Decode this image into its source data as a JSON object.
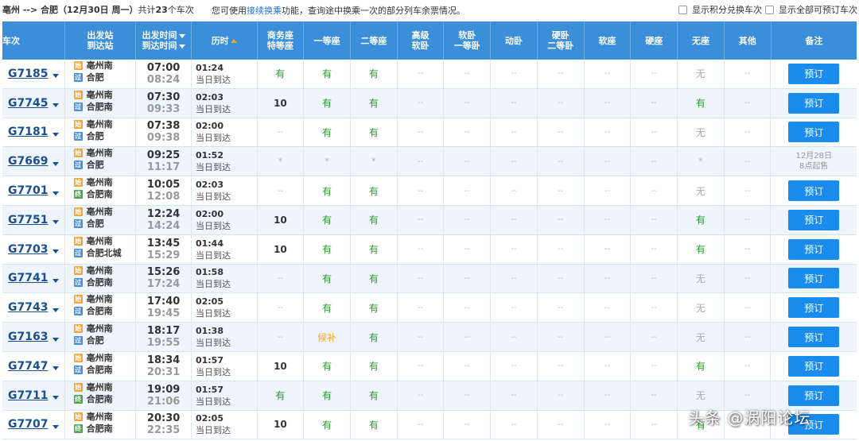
{
  "topbar": {
    "route": "亳州 --> 合肥（12月30日 周一）",
    "count_prefix": "共计",
    "count": "23",
    "count_suffix": "个车次",
    "notice_prefix": "您可使用",
    "notice_link": "接续换乘",
    "notice_suffix": "功能，查询途中换乘一次的部分列车余票情况。",
    "opt1": "显示积分兑换车次",
    "opt2": "显示全部可预订车次"
  },
  "headers": {
    "train": "车次",
    "station_a": "出发站",
    "station_b": "到达站",
    "time_a": "出发时间",
    "time_b": "到达时间",
    "duration": "历时",
    "seat1_a": "商务座",
    "seat1_b": "特等座",
    "seat2": "一等座",
    "seat3": "二等座",
    "seat4_a": "高级",
    "seat4_b": "软卧",
    "seat5_a": "软卧",
    "seat5_b": "一等卧",
    "seat6": "动卧",
    "seat7_a": "硬卧",
    "seat7_b": "二等卧",
    "seat8": "软座",
    "seat9": "硬座",
    "seat10": "无座",
    "seat11": "其他",
    "note": "备注"
  },
  "badges": {
    "start": "始",
    "pass": "过",
    "end": "终"
  },
  "book_label": "预订",
  "rows": [
    {
      "no": "G7185",
      "from": "亳州南",
      "to": "合肥",
      "to_badge": "pass",
      "dep": "07:00",
      "arr": "08:24",
      "dur": "01:24",
      "day": "当日到达",
      "s": [
        "有",
        "有",
        "有",
        "--",
        "--",
        "--",
        "--",
        "--",
        "--",
        "无",
        "--"
      ],
      "note": "book"
    },
    {
      "no": "G7745",
      "from": "亳州南",
      "to": "合肥南",
      "to_badge": "pass",
      "dep": "07:30",
      "arr": "09:33",
      "dur": "02:03",
      "day": "当日到达",
      "s": [
        "10",
        "有",
        "有",
        "--",
        "--",
        "--",
        "--",
        "--",
        "--",
        "有",
        "--"
      ],
      "note": "book"
    },
    {
      "no": "G7181",
      "from": "亳州南",
      "to": "合肥",
      "to_badge": "pass",
      "dep": "07:38",
      "arr": "09:38",
      "dur": "02:00",
      "day": "当日到达",
      "s": [
        "--",
        "有",
        "有",
        "--",
        "--",
        "--",
        "--",
        "--",
        "--",
        "无",
        "--"
      ],
      "note": "book"
    },
    {
      "no": "G7669",
      "from": "亳州南",
      "to": "合肥",
      "to_badge": "pass",
      "dep": "09:25",
      "arr": "11:17",
      "dur": "01:52",
      "day": "当日到达",
      "s": [
        "*",
        "*",
        "*",
        "--",
        "--",
        "--",
        "--",
        "--",
        "--",
        "*",
        "--"
      ],
      "note": "presale",
      "presale_1": "12月28日",
      "presale_2": "8点起售"
    },
    {
      "no": "G7701",
      "from": "亳州南",
      "to": "合肥南",
      "to_badge": "end",
      "dep": "10:05",
      "arr": "12:08",
      "dur": "02:03",
      "day": "当日到达",
      "s": [
        "--",
        "有",
        "有",
        "--",
        "--",
        "--",
        "--",
        "--",
        "--",
        "无",
        "--"
      ],
      "note": "book"
    },
    {
      "no": "G7751",
      "from": "亳州南",
      "to": "合肥",
      "to_badge": "pass",
      "dep": "12:24",
      "arr": "14:24",
      "dur": "02:00",
      "day": "当日到达",
      "s": [
        "10",
        "有",
        "有",
        "--",
        "--",
        "--",
        "--",
        "--",
        "--",
        "有",
        "--"
      ],
      "note": "book"
    },
    {
      "no": "G7703",
      "from": "亳州南",
      "to": "合肥北城",
      "to_badge": "pass",
      "dep": "13:45",
      "arr": "15:29",
      "dur": "01:44",
      "day": "当日到达",
      "s": [
        "10",
        "有",
        "有",
        "--",
        "--",
        "--",
        "--",
        "--",
        "--",
        "有",
        "--"
      ],
      "note": "book"
    },
    {
      "no": "G7741",
      "from": "亳州南",
      "to": "合肥南",
      "to_badge": "pass",
      "dep": "15:26",
      "arr": "17:24",
      "dur": "01:58",
      "day": "当日到达",
      "s": [
        "--",
        "有",
        "有",
        "--",
        "--",
        "--",
        "--",
        "--",
        "--",
        "无",
        "--"
      ],
      "note": "book"
    },
    {
      "no": "G7743",
      "from": "亳州南",
      "to": "合肥南",
      "to_badge": "pass",
      "dep": "17:40",
      "arr": "19:45",
      "dur": "02:05",
      "day": "当日到达",
      "s": [
        "--",
        "有",
        "有",
        "--",
        "--",
        "--",
        "--",
        "--",
        "--",
        "无",
        "--"
      ],
      "note": "book"
    },
    {
      "no": "G7163",
      "from": "亳州南",
      "to": "合肥",
      "to_badge": "pass",
      "dep": "18:17",
      "arr": "19:55",
      "dur": "01:38",
      "day": "当日到达",
      "s": [
        "--",
        "候补",
        "有",
        "--",
        "--",
        "--",
        "--",
        "--",
        "--",
        "无",
        "--"
      ],
      "note": "book"
    },
    {
      "no": "G7747",
      "from": "亳州南",
      "to": "合肥南",
      "to_badge": "pass",
      "dep": "18:34",
      "arr": "20:31",
      "dur": "01:57",
      "day": "当日到达",
      "s": [
        "10",
        "有",
        "有",
        "--",
        "--",
        "--",
        "--",
        "--",
        "--",
        "有",
        "--"
      ],
      "note": "book"
    },
    {
      "no": "G7711",
      "from": "亳州南",
      "to": "合肥南",
      "to_badge": "end",
      "dep": "19:09",
      "arr": "21:06",
      "dur": "01:57",
      "day": "当日到达",
      "s": [
        "有",
        "有",
        "有",
        "--",
        "--",
        "--",
        "--",
        "--",
        "--",
        "无",
        "--"
      ],
      "note": "book"
    },
    {
      "no": "G7707",
      "from": "亳州南",
      "to": "合肥南",
      "to_badge": "end",
      "dep": "20:30",
      "arr": "22:35",
      "dur": "02:05",
      "day": "当日到达",
      "s": [
        "10",
        "有",
        "有",
        "--",
        "--",
        "--",
        "--",
        "--",
        "--",
        "有",
        "--"
      ],
      "note": "book"
    }
  ],
  "watermark": "头条 @涡阳论坛",
  "colors": {
    "header_bg": "#3b8fd8",
    "book_bg": "#1a8cf0",
    "have": "#2b9a2b",
    "few": "#f5a623"
  }
}
